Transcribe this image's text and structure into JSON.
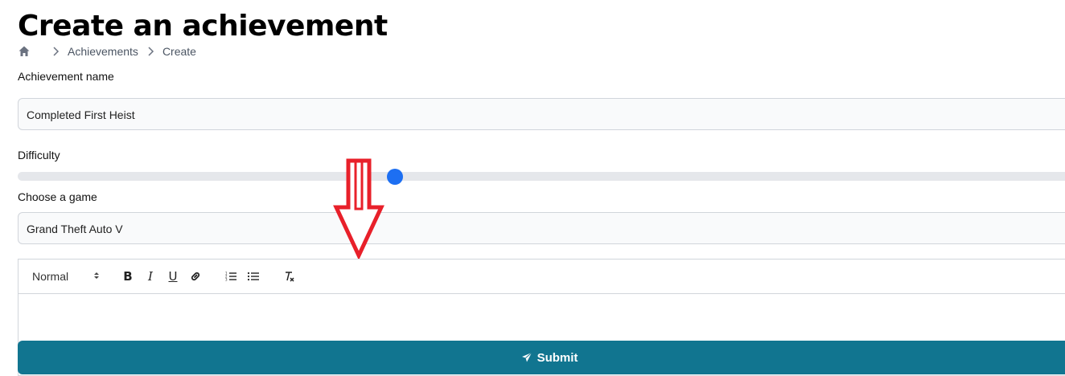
{
  "page": {
    "title": "Create an achievement"
  },
  "breadcrumb": {
    "items": [
      "Achievements",
      "Create"
    ]
  },
  "form": {
    "name_label": "Achievement name",
    "name_value": "Completed First Heist",
    "difficulty_label": "Difficulty",
    "difficulty_value": 0.355,
    "game_label": "Choose a game",
    "game_value": "Grand Theft Auto V",
    "accent_color": "#1d6ff2"
  },
  "editor": {
    "format_select": "Normal",
    "toolbar_icons": [
      "bold-icon",
      "italic-icon",
      "underline-icon",
      "link-icon",
      "ordered-list-icon",
      "bullet-list-icon",
      "clear-format-icon"
    ],
    "content": ""
  },
  "submit": {
    "label": "Submit",
    "color": "#117590",
    "icon": "send-icon"
  },
  "annotation": {
    "arrow_color": "#e8202a",
    "icon": "down-arrow-icon"
  }
}
